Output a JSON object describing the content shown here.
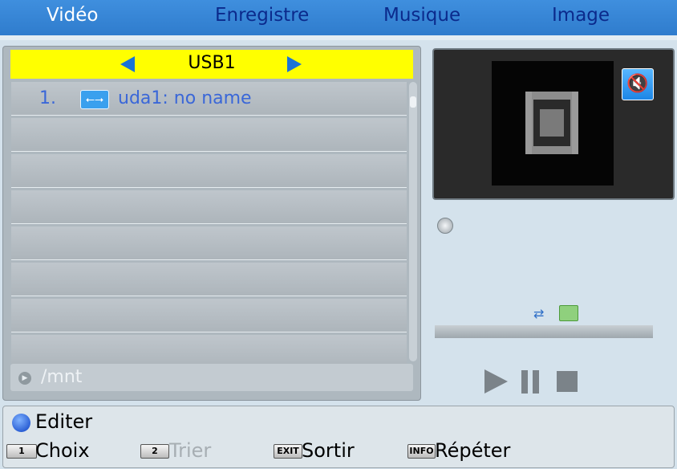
{
  "tabs": [
    {
      "label": "Vidéo",
      "active": true
    },
    {
      "label": "Enregistre",
      "active": false
    },
    {
      "label": "Musique",
      "active": false
    },
    {
      "label": "Image",
      "active": false
    }
  ],
  "device": {
    "name": "USB1"
  },
  "files": [
    {
      "index": "1.",
      "icon": "usb-icon",
      "name": "uda1: no name"
    }
  ],
  "path": "/mnt",
  "preview": {
    "icon": "film-icon",
    "mute_icon": "mute-icon"
  },
  "bottom": {
    "edit_label": "Editer",
    "keys": [
      {
        "key": "1",
        "label": "Choix",
        "enabled": true
      },
      {
        "key": "2",
        "label": "Trier",
        "enabled": false
      },
      {
        "key": "EXIT",
        "label": "Sortir",
        "enabled": true
      },
      {
        "key": "INFO",
        "label": "Répéter",
        "enabled": true
      }
    ]
  },
  "colors": {
    "accent": "#2f7ccd",
    "highlight": "#ffff00",
    "text_blue": "#3a67d8"
  }
}
